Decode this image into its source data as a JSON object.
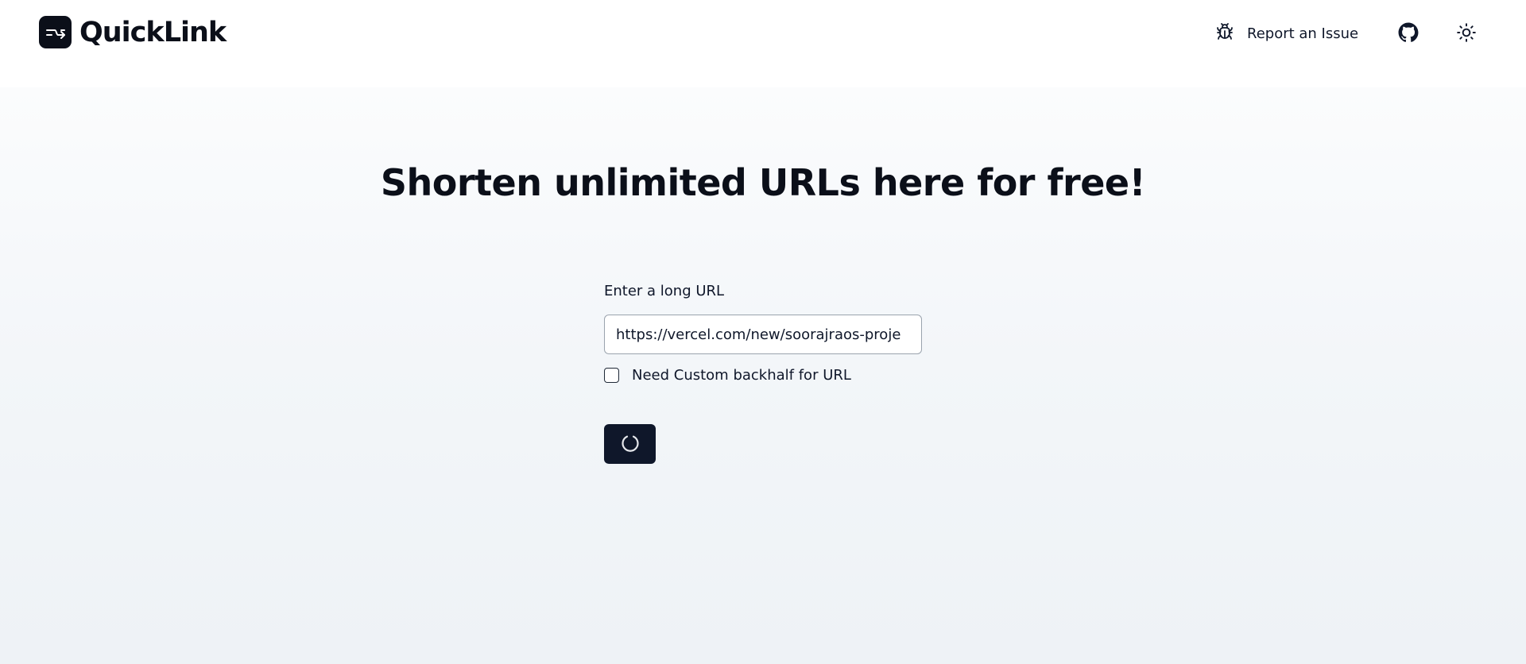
{
  "header": {
    "brand_name": "QuickLink",
    "logo_icon": "link-swap-icon",
    "report_label": "Report an Issue",
    "report_icon": "bug-icon",
    "github_icon": "github-icon",
    "theme_icon": "sun-icon"
  },
  "main": {
    "headline": "Shorten unlimited URLs here for free!",
    "url_label": "Enter a long URL",
    "url_value": "https://vercel.com/new/soorajraos-proje",
    "custom_backhalf_label": "Need Custom backhalf for URL",
    "custom_backhalf_checked": false,
    "submit_state": "loading",
    "submit_icon": "spinner-icon"
  },
  "colors": {
    "primary": "#0f172a",
    "text": "#0f172a",
    "background": "#f3f6f9"
  }
}
